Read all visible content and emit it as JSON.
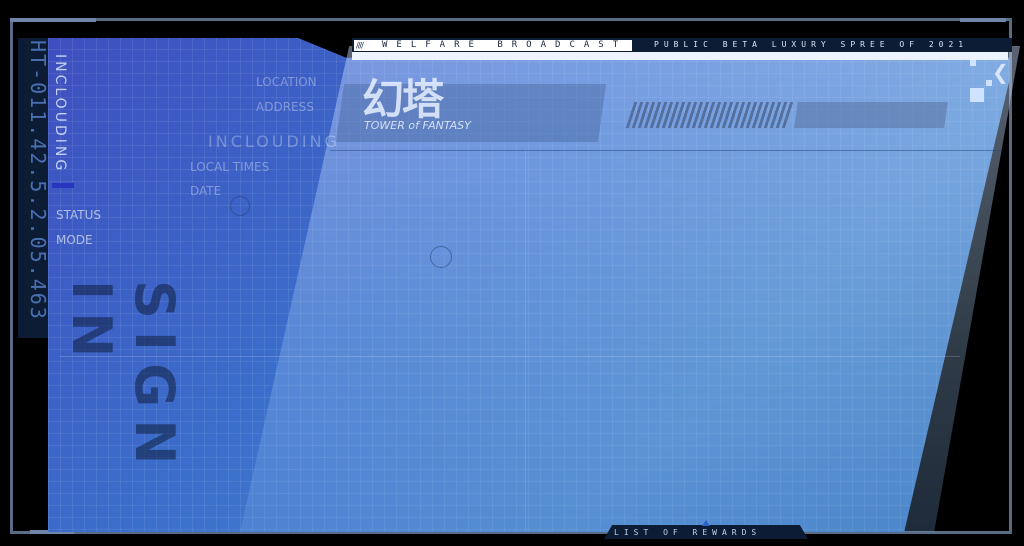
{
  "header": {
    "broadcast_label": "WELFARE BROADCAST",
    "spree_label": "PUBLIC BETA LUXURY SPREE OF 2021",
    "ticks": "////"
  },
  "logo": {
    "cn": "幻塔",
    "en": "TOWER of FANTASY"
  },
  "sidebar": {
    "rail_code": "HT-011.42.5.2.05.463",
    "vertical_label": "INCLOUDING",
    "heading": "INCLOUDING",
    "sign_in": "SIGN IN"
  },
  "info_labels": {
    "location": "LOCATION",
    "address": "ADDRESS",
    "local_times": "LOCAL TIMES",
    "date": "DATE",
    "status": "STATUS",
    "mode": "MODE"
  },
  "footer": {
    "rewards_label": "LIST OF REWARDS"
  },
  "icons": {
    "back": "back-arrow-icon"
  },
  "colors": {
    "frame": "#5a6b85",
    "panel": "#3b6fcc",
    "accent": "#2a35c0",
    "dark": "#0c1c34"
  }
}
